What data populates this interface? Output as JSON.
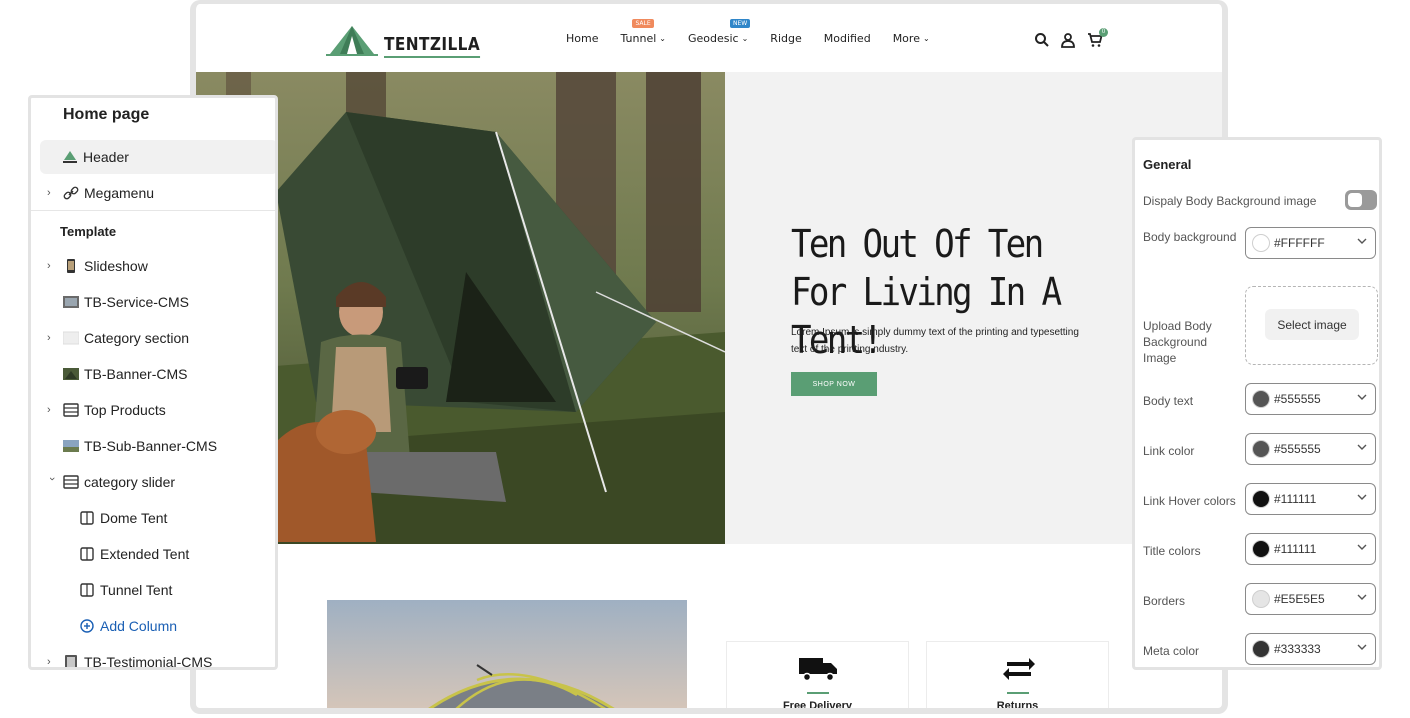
{
  "site": {
    "logo_text": "TENTZILLA",
    "logo_mini_text": "TENTZILLA",
    "nav": [
      {
        "label": "Home",
        "has_dropdown": false,
        "badge": ""
      },
      {
        "label": "Tunnel",
        "has_dropdown": true,
        "badge": "SALE"
      },
      {
        "label": "Geodesic",
        "has_dropdown": true,
        "badge": "NEW"
      },
      {
        "label": "Ridge",
        "has_dropdown": false,
        "badge": ""
      },
      {
        "label": "Modified",
        "has_dropdown": false,
        "badge": ""
      },
      {
        "label": "More",
        "has_dropdown": true,
        "badge": ""
      }
    ],
    "nav_chevron": "⌄",
    "cart_count": "0",
    "hero": {
      "title": "Ten Out Of Ten For Living In A Tent!",
      "description": "Lorem Ipsum is simply dummy text of the printing and typesetting text of the printing ndustry.",
      "button_label": "SHOP NOW"
    },
    "features": [
      {
        "label": "Free Delivery",
        "icon": "truck-icon"
      },
      {
        "label": "Returns",
        "icon": "return-icon"
      }
    ],
    "colors": {
      "accent": "#5a9e74",
      "sale_badge": "#f08a5d",
      "new_badge": "#2f86c9"
    }
  },
  "left_panel": {
    "title": "Home page",
    "items": [
      {
        "label": "Header",
        "expandable": false,
        "active": true,
        "icon": "logo-thumb-icon"
      },
      {
        "label": "Megamenu",
        "expandable": true,
        "active": false,
        "icon": "link-icon"
      }
    ],
    "template_title": "Template",
    "template_items": [
      {
        "label": "Slideshow",
        "expandable": true,
        "icon": "phone-thumb-icon",
        "indent": 0
      },
      {
        "label": "TB-Service-CMS",
        "expandable": false,
        "icon": "image-thumb-icon",
        "indent": 0
      },
      {
        "label": "Category section",
        "expandable": true,
        "icon": "image-thumb-icon",
        "indent": 0
      },
      {
        "label": "TB-Banner-CMS",
        "expandable": false,
        "icon": "image-thumb-icon",
        "indent": 0
      },
      {
        "label": "Top Products",
        "expandable": true,
        "icon": "grid-icon",
        "indent": 0
      },
      {
        "label": "TB-Sub-Banner-CMS",
        "expandable": false,
        "icon": "image-thumb-icon",
        "indent": 0
      },
      {
        "label": "category slider",
        "expandable": true,
        "expanded": true,
        "icon": "grid-icon",
        "indent": 0
      },
      {
        "label": "Dome Tent",
        "expandable": false,
        "icon": "column-icon",
        "indent": 1
      },
      {
        "label": "Extended Tent",
        "expandable": false,
        "icon": "column-icon",
        "indent": 1
      },
      {
        "label": "Tunnel Tent",
        "expandable": false,
        "icon": "column-icon",
        "indent": 1
      },
      {
        "label": "Add Column",
        "expandable": false,
        "icon": "add-circle-icon",
        "indent": 1,
        "link": true
      },
      {
        "label": "TB-Testimonial-CMS",
        "expandable": true,
        "icon": "phone-thumb-icon",
        "indent": 0
      }
    ],
    "link_color": "#1a5fb4"
  },
  "right_panel": {
    "title": "General",
    "toggle_label": "Dispaly Body Background image",
    "toggle_on": false,
    "upload_label": "Upload Body Background Image",
    "select_image_label": "Select image",
    "color_settings": [
      {
        "label": "Body background",
        "value": "#FFFFFF",
        "swatch": "#FFFFFF"
      },
      {
        "label": "Body text",
        "value": "#555555",
        "swatch": "#555555"
      },
      {
        "label": "Link color",
        "value": "#555555",
        "swatch": "#555555"
      },
      {
        "label": "Link Hover colors",
        "value": "#111111",
        "swatch": "#111111"
      },
      {
        "label": "Title colors",
        "value": "#111111",
        "swatch": "#111111"
      },
      {
        "label": "Borders",
        "value": "#E5E5E5",
        "swatch": "#E5E5E5"
      },
      {
        "label": "Meta color",
        "value": "#333333",
        "swatch": "#333333"
      }
    ]
  }
}
